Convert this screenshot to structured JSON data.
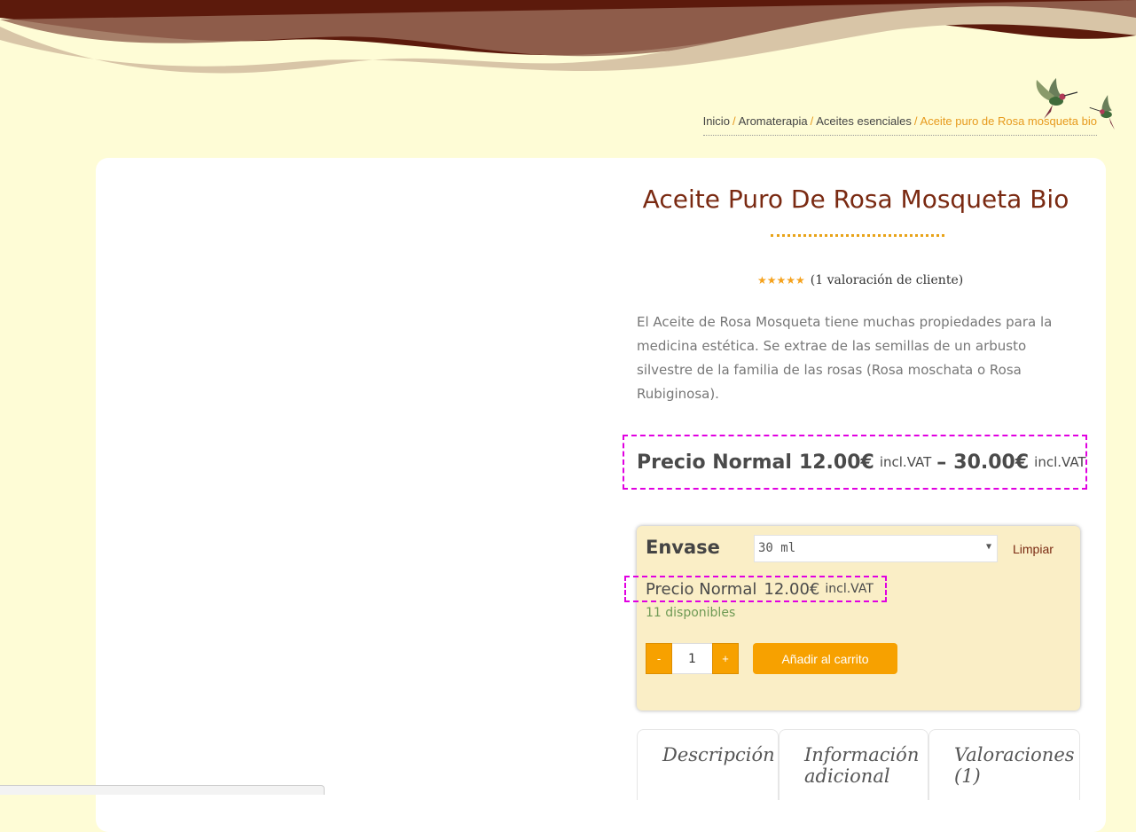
{
  "breadcrumb": {
    "items": [
      "Inicio",
      "Aromaterapia",
      "Aceites esenciales"
    ],
    "separator": "/",
    "current": "Aceite puro de Rosa mosqueta bio"
  },
  "product": {
    "title": "Aceite Puro De Rosa Mosqueta Bio",
    "rating_stars": "★★★★★",
    "rating_text": "(1 valoración de cliente)",
    "description": "El Aceite de Rosa Mosqueta tiene muchas propiedades para la medicina estética. Se extrae de las semillas de un arbusto silvestre de la familia de las rosas (Rosa moschata o Rosa Rubiginosa).",
    "price_range": {
      "label": "Precio Normal",
      "min": "12.00€",
      "dash": "–",
      "max": "30.00€",
      "tax_suffix": "incl.VAT"
    }
  },
  "variation": {
    "label": "Envase",
    "selected": "30 ml",
    "clear_label": "Limpiar",
    "price_label": "Precio Normal",
    "price": "12.00€",
    "tax_suffix": "incl.VAT",
    "stock": "11 disponibles",
    "quantity": "1",
    "minus": "-",
    "plus": "+",
    "add_to_cart": "Añadir al carrito"
  },
  "tabs": [
    {
      "label": "Descripción"
    },
    {
      "label": "Información adicional"
    },
    {
      "label": "Valoraciones (1)"
    }
  ],
  "colors": {
    "background": "#fefcd6",
    "accent": "#f7a100",
    "title": "#7a2a12",
    "highlight_border": "#e100e1",
    "wave_dark": "#5c1a0c",
    "wave_mid": "#966956",
    "wave_light": "#d8c5a7"
  },
  "icons": {
    "header_decoration": "hummingbird-icon",
    "select_arrow": "caret-down-icon"
  }
}
